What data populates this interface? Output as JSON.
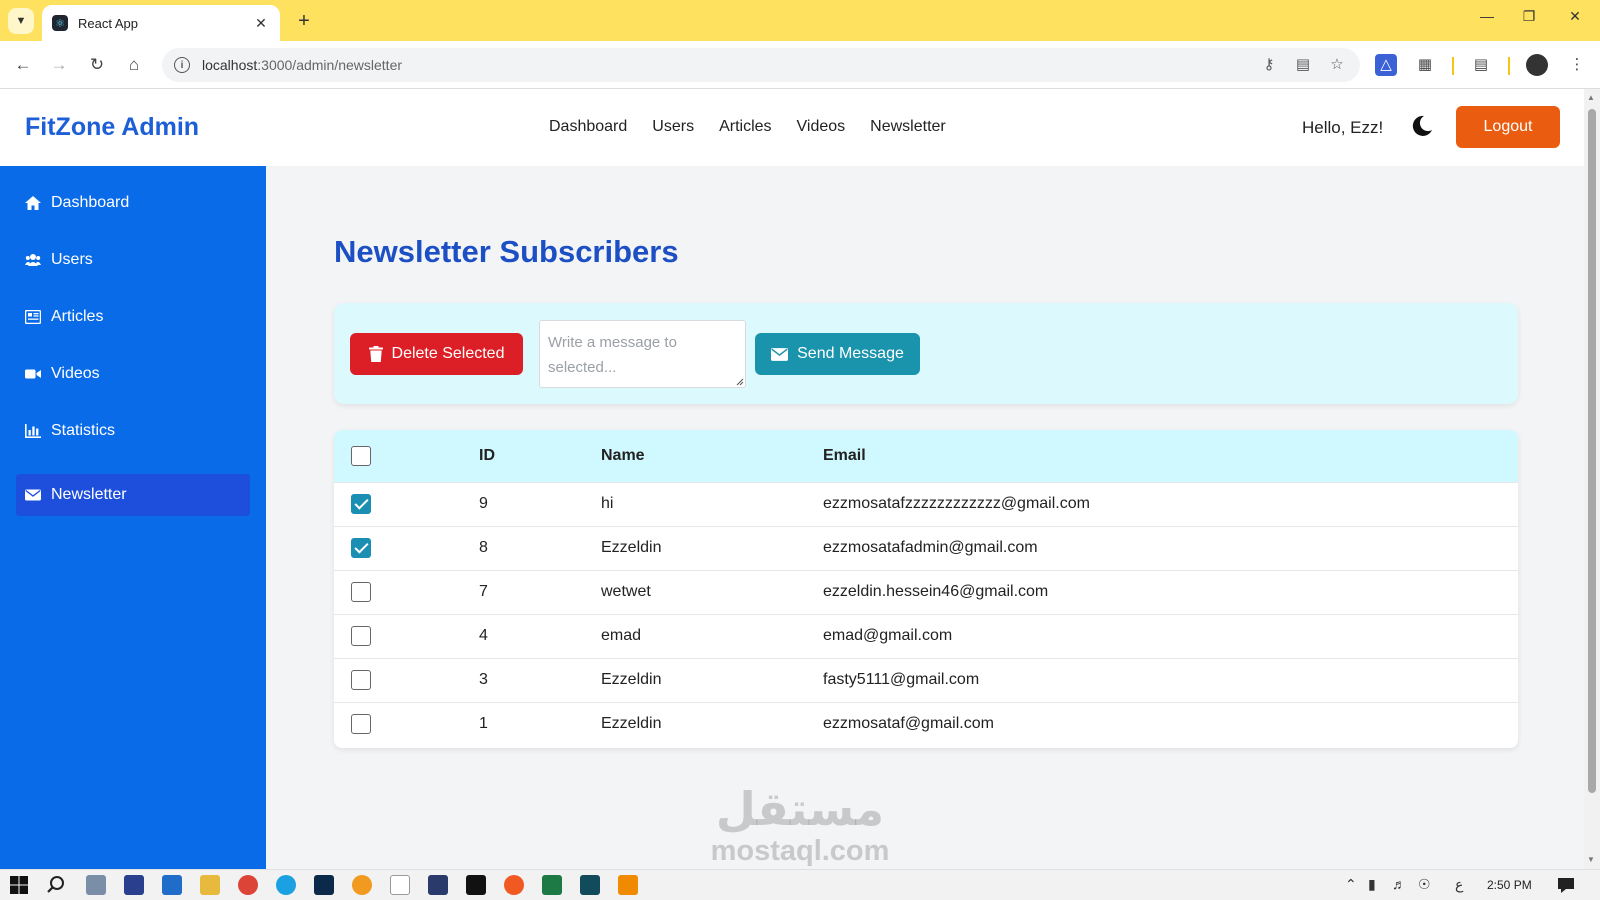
{
  "browser": {
    "tab_title": "React App",
    "url_host": "localhost",
    "url_path": ":3000/admin/newsletter"
  },
  "header": {
    "brand": "FitZone Admin",
    "nav": [
      "Dashboard",
      "Users",
      "Articles",
      "Videos",
      "Newsletter"
    ],
    "greeting": "Hello, Ezz!",
    "logout_label": "Logout"
  },
  "sidebar": {
    "items": [
      {
        "label": "Dashboard",
        "icon": "home-icon"
      },
      {
        "label": "Users",
        "icon": "users-icon"
      },
      {
        "label": "Articles",
        "icon": "newspaper-icon"
      },
      {
        "label": "Videos",
        "icon": "video-camera-icon"
      },
      {
        "label": "Statistics",
        "icon": "bar-chart-icon"
      },
      {
        "label": "Newsletter",
        "icon": "envelope-icon",
        "active": true
      }
    ]
  },
  "main": {
    "title": "Newsletter Subscribers",
    "delete_label": "Delete Selected",
    "message_placeholder": "Write a message to selected...",
    "send_label": "Send Message",
    "table": {
      "headers": [
        "ID",
        "Name",
        "Email"
      ],
      "rows": [
        {
          "checked": true,
          "id": "9",
          "name": "hi",
          "email": "ezzmosatafzzzzzzzzzzzz@gmail.com"
        },
        {
          "checked": true,
          "id": "8",
          "name": "Ezzeldin",
          "email": "ezzmosatafadmin@gmail.com"
        },
        {
          "checked": false,
          "id": "7",
          "name": "wetwet",
          "email": "ezzeldin.hessein46@gmail.com"
        },
        {
          "checked": false,
          "id": "4",
          "name": "emad",
          "email": "emad@gmail.com"
        },
        {
          "checked": false,
          "id": "3",
          "name": "Ezzeldin",
          "email": "fasty5111@gmail.com"
        },
        {
          "checked": false,
          "id": "1",
          "name": "Ezzeldin",
          "email": "ezzmosataf@gmail.com"
        }
      ]
    }
  },
  "watermark": {
    "arabic": "مستقل",
    "latin": "mostaql.com"
  },
  "taskbar": {
    "clock": "2:50 PM",
    "lang": "ع"
  },
  "colors": {
    "brand": "#1d5fd6",
    "sidebar": "#0a6be8",
    "sidebar_active": "#1d4fdc",
    "logout": "#ea5c10",
    "delete": "#dc1f26",
    "send": "#1a93ad",
    "checkbox_checked": "#1a8fb3",
    "table_header": "#cff9fe"
  }
}
